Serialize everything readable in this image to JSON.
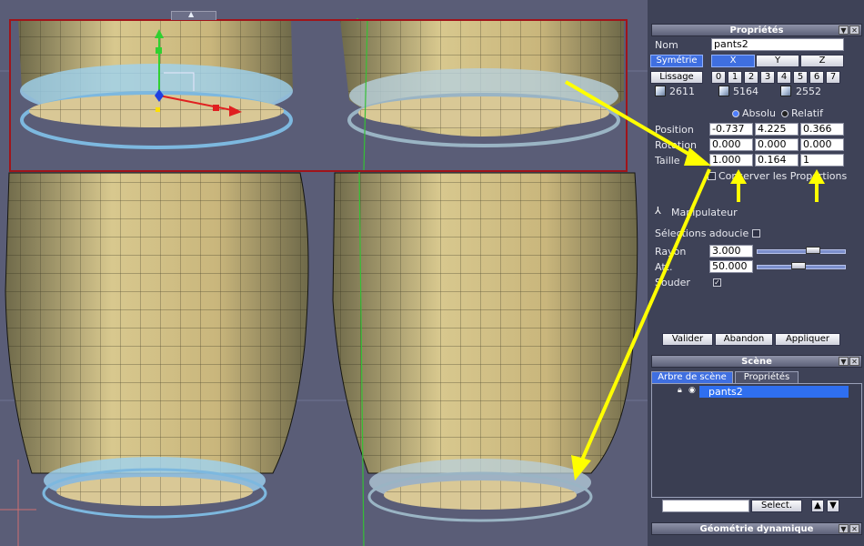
{
  "viewport": {
    "label": "3D viewport"
  },
  "properties": {
    "header": "Propriétés",
    "name_label": "Nom",
    "name_value": "pants2",
    "symmetry_label": "Symétrie",
    "axes": [
      "X",
      "Y",
      "Z"
    ],
    "smoothing_label": "Lissage",
    "smoothing_levels": [
      "0",
      "1",
      "2",
      "3",
      "4",
      "5",
      "6",
      "7"
    ],
    "counts": [
      "2611",
      "5164",
      "2552"
    ],
    "mode_absolute": "Absolu",
    "mode_relative": "Relatif",
    "position_label": "Position",
    "position": [
      "-0.737",
      "4.225",
      "0.366"
    ],
    "rotation_label": "Rotation",
    "rotation": [
      "0.000",
      "0.000",
      "0.000"
    ],
    "size_label": "Taille",
    "size": [
      "1.000",
      "0.164",
      "1"
    ],
    "keep_proportions": "Conserver les Proportions",
    "manipulator": "Manipulateur",
    "soft_selection": "Sélections adoucie",
    "radius_label": "Rayon",
    "radius_value": "3.000",
    "att_label": "Att.",
    "att_value": "50.000",
    "weld_label": "Souder",
    "validate": "Valider",
    "abandon": "Abandon",
    "apply": "Appliquer"
  },
  "scene": {
    "header": "Scène",
    "tab_tree": "Arbre de scène",
    "tab_props": "Propriétés",
    "item": "pants2",
    "select_button": "Select."
  },
  "dynamic": {
    "header": "Géométrie dynamique"
  },
  "colors": {
    "panel": "#3e4257",
    "accent": "#3f6fe0",
    "mesh": "#c8b27a",
    "ring": "#8fc4e6",
    "arrow": "#ffff00",
    "highlight_box": "#a0141a"
  }
}
